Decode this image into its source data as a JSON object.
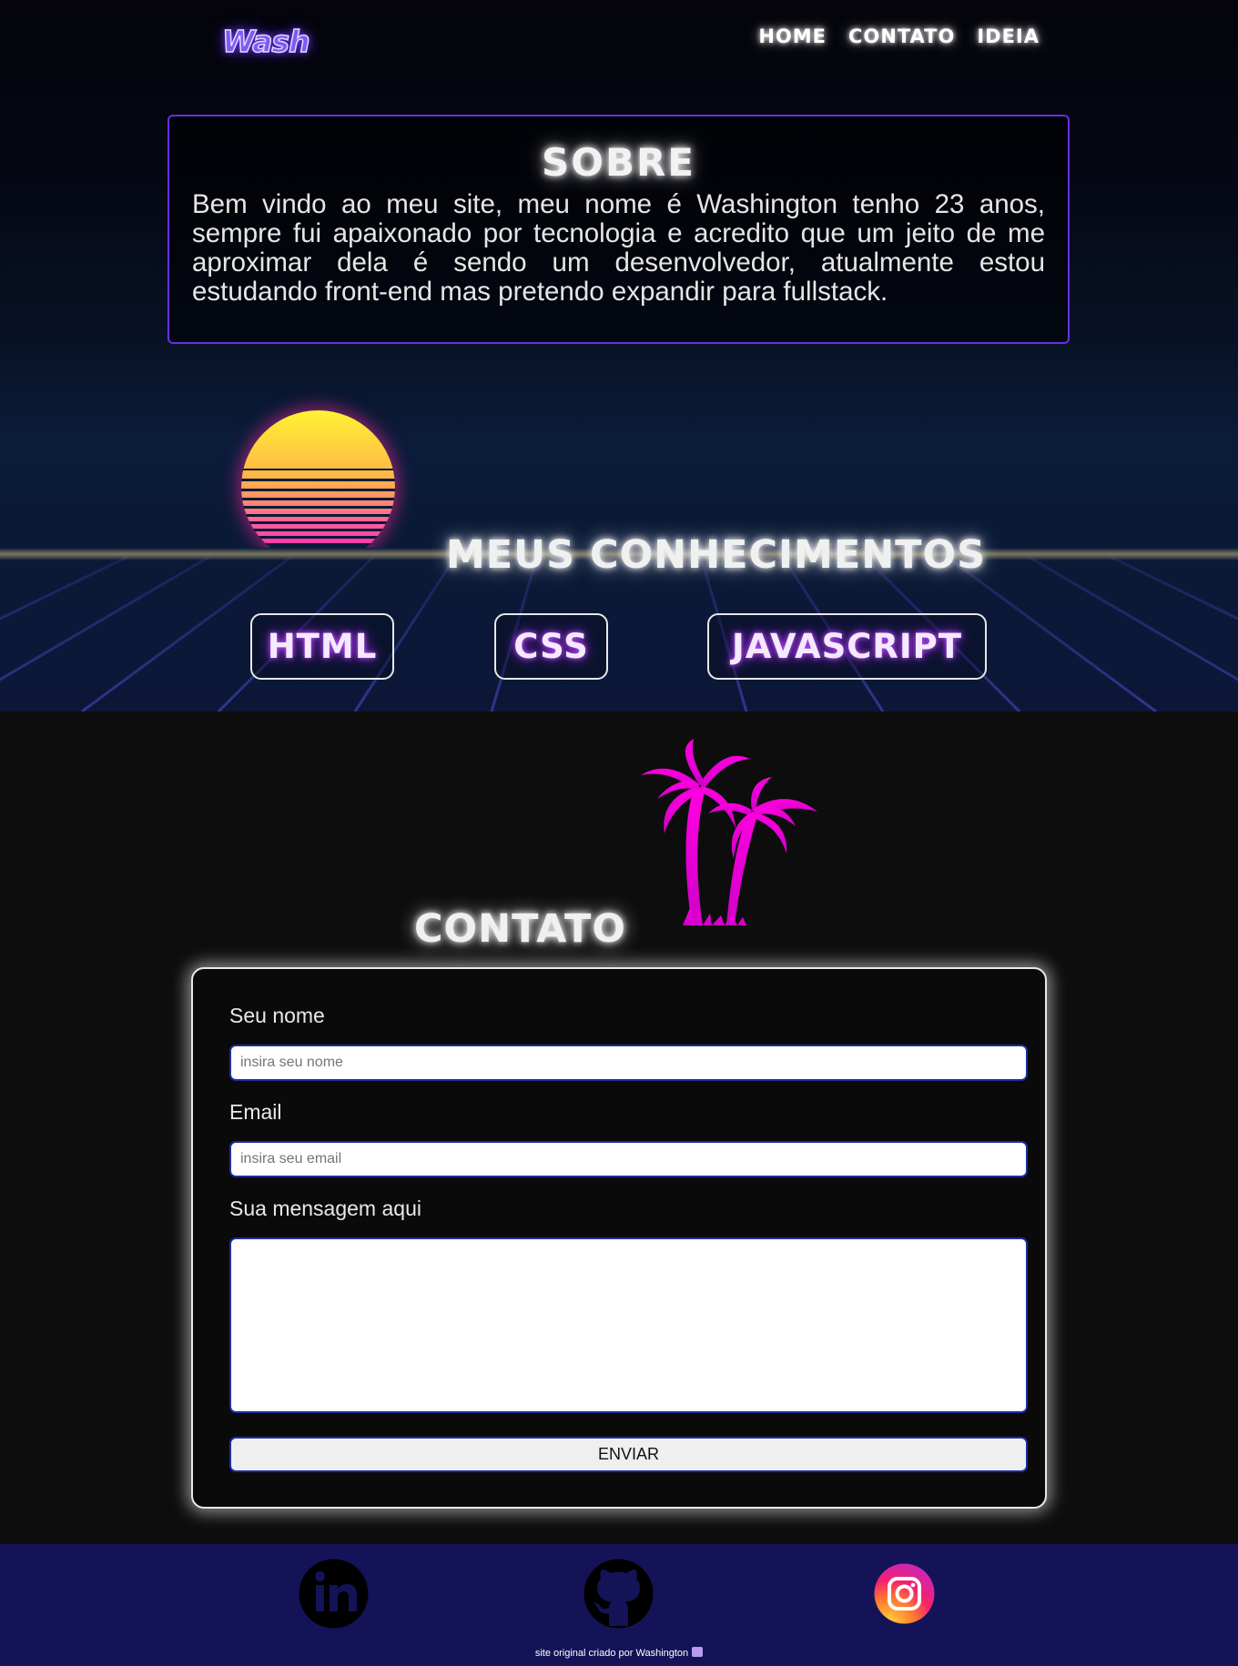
{
  "header": {
    "logo": "Wash",
    "nav": [
      "HOME",
      "CONTATO",
      "IDEIA"
    ]
  },
  "about": {
    "title": "SOBRE",
    "text": "Bem vindo ao meu site, meu nome é Washington tenho 23 anos, sempre fui apaixonado por tecnologia e acredito que um jeito de me aproximar dela é sendo um desenvolvedor, atualmente estou estudando front-end mas pretendo expandir para fullstack."
  },
  "skills": {
    "title": "MEUS CONHECIMENTOS",
    "items": [
      "HTML",
      "CSS",
      "JAVASCRIPT"
    ]
  },
  "contact": {
    "title": "CONTATO",
    "name_label": "Seu nome",
    "name_placeholder": "insira seu nome",
    "email_label": "Email",
    "email_placeholder": "insira seu email",
    "message_label": "Sua mensagem aqui",
    "message_value": "",
    "submit_label": "ENVIAR"
  },
  "footer": {
    "social_icons": [
      "linkedin-icon",
      "github-icon",
      "instagram-icon"
    ],
    "credit": "site original criado por Washington"
  },
  "colors": {
    "accent_purple": "#6a2ee8",
    "neon_pink": "#ff00d0",
    "footer_bg": "#141358",
    "input_border": "#1c2da8"
  }
}
